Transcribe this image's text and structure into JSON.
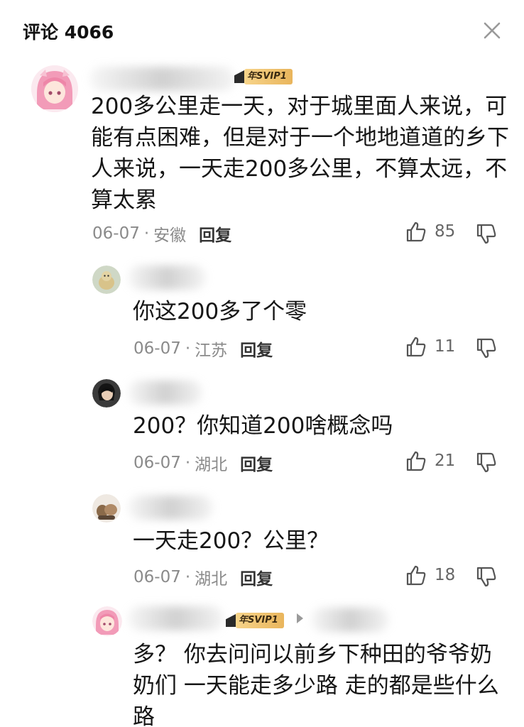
{
  "header": {
    "title": "评论 4066",
    "close_icon": "close-icon"
  },
  "comments": [
    {
      "vip": "年SVIP1",
      "text_lines": [
        "200多公里走一天，对于城里面人来说，可",
        "能有点困难，但是对于一个地地道道的乡下",
        "人来说，一天走200多公里，不算太远，不",
        "算太累"
      ],
      "date": "06-07",
      "location": "安徽",
      "reply": "回复",
      "likes": "85"
    },
    {
      "text_lines": [
        "你这200多了个零"
      ],
      "date": "06-07",
      "location": "江苏",
      "reply": "回复",
      "likes": "11"
    },
    {
      "text_lines": [
        "200？你知道200啥概念吗"
      ],
      "date": "06-07",
      "location": "湖北",
      "reply": "回复",
      "likes": "21"
    },
    {
      "text_lines": [
        "一天走200？公里？"
      ],
      "date": "06-07",
      "location": "湖北",
      "reply": "回复",
      "likes": "18"
    },
    {
      "vip": "年SVIP1",
      "text_lines": [
        "多？ 你去问问以前乡下种田的爷爷奶",
        "奶们 一天能走多少路 走的都是些什么",
        "路"
      ]
    }
  ],
  "icons": {
    "like": "thumbs-up-icon",
    "dislike": "thumbs-down-icon"
  }
}
